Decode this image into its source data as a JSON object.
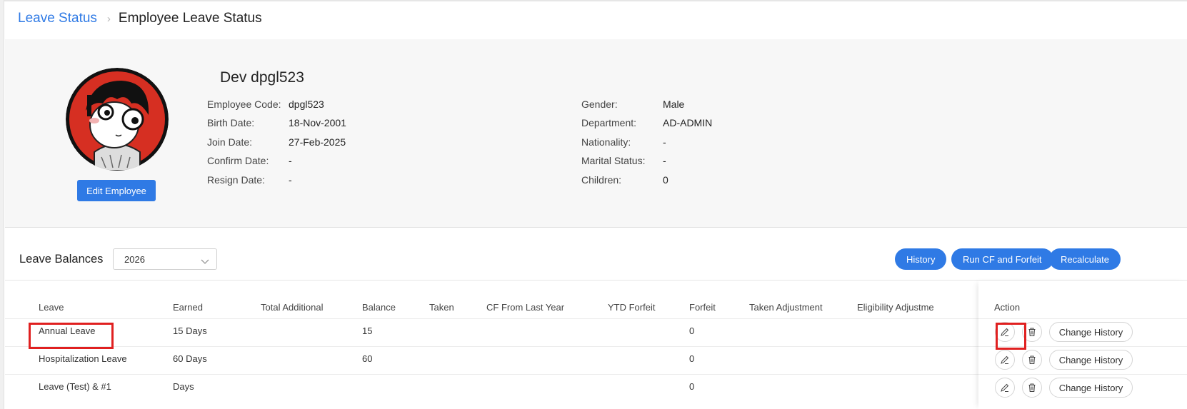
{
  "breadcrumb": {
    "parent": "Leave Status",
    "separator": "›",
    "current": "Employee Leave Status"
  },
  "employee": {
    "name": "Dev dpgl523",
    "edit_button": "Edit Employee",
    "left_fields": [
      {
        "label": "Employee Code:",
        "value": "dpgl523"
      },
      {
        "label": "Birth Date:",
        "value": "18-Nov-2001"
      },
      {
        "label": "Join Date:",
        "value": "27-Feb-2025"
      },
      {
        "label": "Confirm Date:",
        "value": "-"
      },
      {
        "label": "Resign Date:",
        "value": "-"
      }
    ],
    "right_fields": [
      {
        "label": "Gender:",
        "value": "Male"
      },
      {
        "label": "Department:",
        "value": "AD-ADMIN"
      },
      {
        "label": "Nationality:",
        "value": "-"
      },
      {
        "label": "Marital Status:",
        "value": "-"
      },
      {
        "label": "Children:",
        "value": "0"
      }
    ]
  },
  "leave_balances": {
    "title": "Leave Balances",
    "year": "2026",
    "buttons": {
      "history": "History",
      "run_cf": "Run CF and Forfeit",
      "recalculate": "Recalculate"
    },
    "columns": [
      "Leave",
      "Earned",
      "Total Additional",
      "Balance",
      "Taken",
      "CF From Last Year",
      "YTD Forfeit",
      "Forfeit",
      "Taken Adjustment",
      "Eligibility Adjustme",
      "Action"
    ],
    "rows": [
      {
        "leave": "Annual Leave",
        "earned": "15 Days",
        "total_additional": "",
        "balance": "15",
        "taken": "",
        "cf": "",
        "ytd_forfeit": "",
        "forfeit": "0",
        "taken_adj": "",
        "eligibility_adj": "",
        "change_history": "Change History"
      },
      {
        "leave": "Hospitalization Leave",
        "earned": "60 Days",
        "total_additional": "",
        "balance": "60",
        "taken": "",
        "cf": "",
        "ytd_forfeit": "",
        "forfeit": "0",
        "taken_adj": "",
        "eligibility_adj": "",
        "change_history": "Change History"
      },
      {
        "leave": "Leave (Test) & #1",
        "earned": "Days",
        "total_additional": "",
        "balance": "",
        "taken": "",
        "cf": "",
        "ytd_forfeit": "",
        "forfeit": "0",
        "taken_adj": "",
        "eligibility_adj": "",
        "change_history": "Change History"
      }
    ]
  },
  "icons": {
    "edit": "pencil-icon",
    "delete": "trash-icon",
    "dropdown": "chevron-down-icon"
  },
  "colors": {
    "accent": "#2f7ae5",
    "highlight": "#e02020"
  }
}
